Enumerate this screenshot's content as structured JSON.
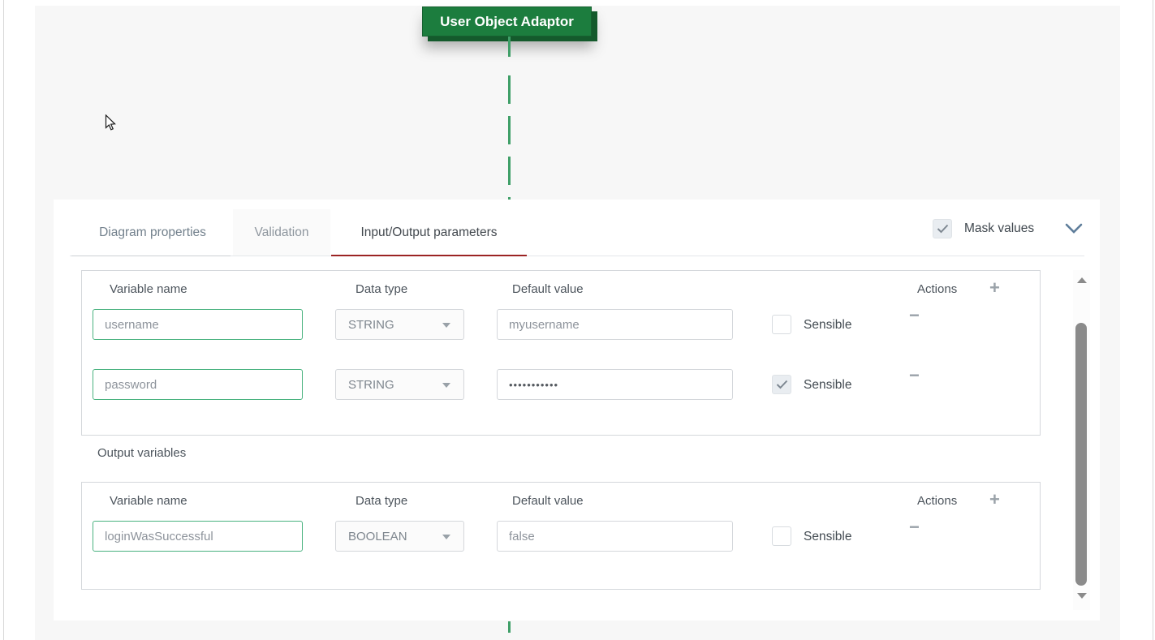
{
  "diagram": {
    "node_label": "User Object Adaptor",
    "node_color": "#1c7d3e",
    "connector_color": "#3f9f68"
  },
  "panel": {
    "tabs": [
      {
        "label": "Diagram properties"
      },
      {
        "label": "Validation"
      },
      {
        "label": "Input/Output parameters"
      }
    ],
    "active_tab": "Input/Output parameters",
    "active_tab_underline_color": "#9b2323",
    "mask_values": {
      "label": "Mask values",
      "checked": true
    },
    "columns": {
      "variable_name": "Variable name",
      "data_type": "Data type",
      "default_value": "Default value",
      "actions": "Actions"
    },
    "sensible_label": "Sensible",
    "input_rows": [
      {
        "variable_name": "username",
        "data_type": "STRING",
        "default_value": "myusername",
        "sensible_checked": false
      },
      {
        "variable_name": "password",
        "data_type": "STRING",
        "default_value": "•••••••••••",
        "sensible_checked": true
      }
    ],
    "output_section_label": "Output variables",
    "output_rows": [
      {
        "variable_name": "loginWasSuccessful",
        "data_type": "BOOLEAN",
        "default_value": "false",
        "sensible_checked": false
      }
    ]
  },
  "icons": {
    "plus": "+",
    "minus": "−",
    "check": "✓",
    "chevron_down": "⌄",
    "dropdown_caret": "▾",
    "scroll_up": "▲",
    "scroll_down": "▼"
  },
  "colors": {
    "input_focus_border": "#49b27f",
    "canvas_bg": "#f7f7f7"
  }
}
